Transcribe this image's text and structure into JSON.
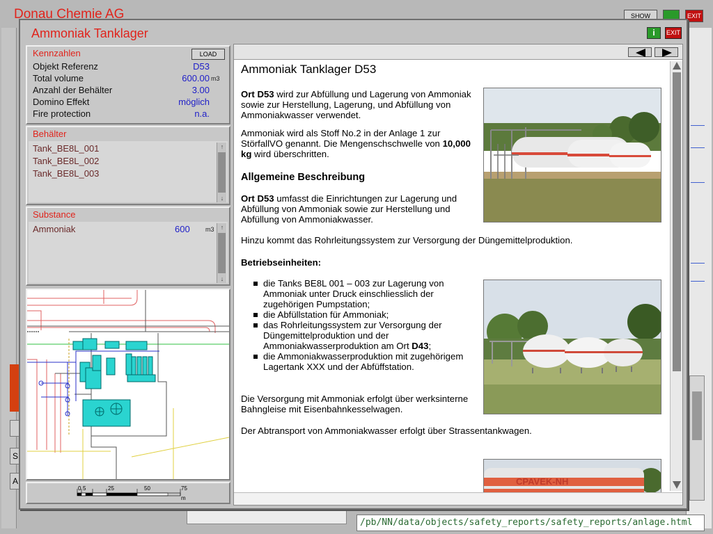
{
  "background_app": {
    "title": "Donau Chemie AG",
    "show_button": "SHOW",
    "exit_button": "EXIT",
    "stub_labels": [
      "S",
      "A"
    ],
    "url": "/pb/NN/data/objects/safety_reports/safety_reports/anlage.html"
  },
  "window": {
    "title": "Ammoniak Tanklager",
    "info_label": "i",
    "exit_label": "EXIT"
  },
  "kennzahlen": {
    "header": "Kennzahlen",
    "load_label": "LOAD",
    "rows": [
      {
        "label": "Objekt Referenz",
        "value": "D53",
        "unit": ""
      },
      {
        "label": "Total volume",
        "value": "600.00",
        "unit": "m3"
      },
      {
        "label": "Anzahl der Behälter",
        "value": "3.00",
        "unit": ""
      },
      {
        "label": "Domino Effekt",
        "value": "möglich",
        "unit": ""
      },
      {
        "label": "Fire protection",
        "value": "n.a.",
        "unit": ""
      }
    ]
  },
  "behaelter": {
    "header": "Behälter",
    "items": [
      "Tank_BE8L_001",
      "Tank_BE8L_002",
      "Tank_BE8L_003"
    ]
  },
  "substance": {
    "header": "Substance",
    "name": "Ammoniak",
    "value": "600",
    "unit": "m3"
  },
  "scale": {
    "ticks": [
      "0",
      "5",
      "25",
      "50",
      "75"
    ],
    "unit": "m"
  },
  "document": {
    "title": "Ammoniak Tanklager D53",
    "p1_bold": "Ort D53",
    "p1_rest": " wird zur Abfüllung und Lagerung von Ammoniak sowie zur Herstellung, Lagerung, und Abfüllung von Ammoniakwasser verwendet.",
    "p2_pre": "Ammoniak wird als Stoff No.2 in der Anlage 1 zur StörfallVO genannt. Die Mengenschschwelle von ",
    "p2_bold": "10,000 kg",
    "p2_post": " wird überschritten.",
    "h_allgemein": "Allgemeine Beschreibung",
    "p3_bold": "Ort D53",
    "p3_rest": " umfasst die Einrichtungen zur Lagerung und Abfüllung von Ammoniak sowie zur Herstellung und Abfüllung von Ammoniakwasser.",
    "p4": "Hinzu kommt das Rohrleitungssystem zur Versorgung der Düngemittelproduktion.",
    "h_betrieb": "Betriebseinheiten:",
    "bullets": [
      "die Tanks BE8L 001 – 003 zur Lagerung von Ammoniak unter Druck einschliesslich der zugehörigen Pumpstation;",
      "die Abfüllstation für Ammoniak;",
      "das Rohrleitungssystem zur Versorgung der Düngemittelproduktion und der Ammoniakwasserproduktion am Ort ",
      "die Ammoniakwasserproduktion mit zugehörigem Lagertank XXX und der Abfüffstation."
    ],
    "bullet3_bold": "D43",
    "bullet3_end": ";",
    "p5": "Die Versorgung mit Ammoniak erfolgt über werksinterne Bahngleise mit Eisenbahnkesselwagen.",
    "p6": "Der Abtransport von Ammoniakwasser erfolgt über Strassentankwagen.",
    "wagon_lettering": "CPAVEK-NH"
  },
  "colors": {
    "title_red": "#e0241c",
    "value_blue": "#2020c8",
    "map_cyan": "#2ad4d0"
  }
}
